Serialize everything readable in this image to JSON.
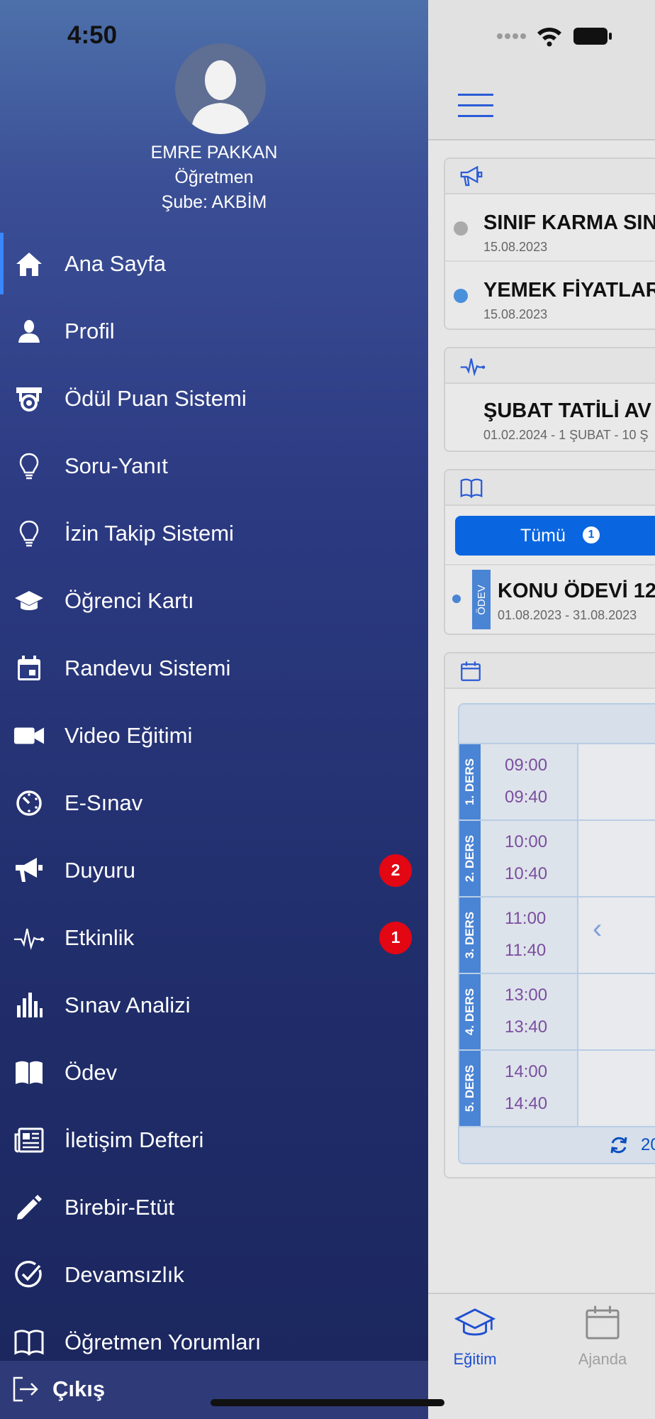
{
  "status": {
    "time": "4:50"
  },
  "profile": {
    "name": "EMRE PAKKAN",
    "role": "Öğretmen",
    "branch": "Şube: AKBİM"
  },
  "menu": [
    {
      "label": "Ana Sayfa",
      "icon": "home-icon",
      "active": true
    },
    {
      "label": "Profil",
      "icon": "person-icon"
    },
    {
      "label": "Ödül Puan Sistemi",
      "icon": "award-icon"
    },
    {
      "label": "Soru-Yanıt",
      "icon": "lightbulb-icon"
    },
    {
      "label": "İzin Takip Sistemi",
      "icon": "lightbulb-icon"
    },
    {
      "label": "Öğrenci Kartı",
      "icon": "graduation-cap-icon"
    },
    {
      "label": "Randevu Sistemi",
      "icon": "calendar-icon"
    },
    {
      "label": "Video Eğitimi",
      "icon": "video-camera-icon"
    },
    {
      "label": "E-Sınav",
      "icon": "timer-icon"
    },
    {
      "label": "Duyuru",
      "icon": "megaphone-icon",
      "badge": "2"
    },
    {
      "label": "Etkinlik",
      "icon": "activity-icon",
      "badge": "1"
    },
    {
      "label": "Sınav Analizi",
      "icon": "bar-chart-icon"
    },
    {
      "label": "Ödev",
      "icon": "book-icon"
    },
    {
      "label": "İletişim Defteri",
      "icon": "newspaper-icon"
    },
    {
      "label": "Birebir-Etüt",
      "icon": "pencil-icon"
    },
    {
      "label": "Devamsızlık",
      "icon": "check-circle-icon"
    },
    {
      "label": "Öğretmen Yorumları",
      "icon": "open-book-icon"
    }
  ],
  "logout": {
    "label": "Çıkış",
    "icon": "logout-icon"
  },
  "announcements": {
    "icon": "megaphone-icon",
    "items": [
      {
        "title": "SINIF KARMA SIN",
        "date": "15.08.2023",
        "dot_color": "#aaaaaa"
      },
      {
        "title": "YEMEK FİYATLAR",
        "date": "15.08.2023",
        "dot_color": "#4a8fdc"
      }
    ]
  },
  "events": {
    "icon": "activity-icon",
    "items": [
      {
        "title": "ŞUBAT TATİLİ AV",
        "date": "01.02.2024 - 1 ŞUBAT - 10 Ş"
      }
    ]
  },
  "homework": {
    "icon": "book-icon",
    "filter_label": "Tümü",
    "filter_count": "1",
    "items": [
      {
        "tag": "ÖDEV",
        "title": "KONU ÖDEVİ 12.",
        "date": "01.08.2023 -  31.08.2023"
      }
    ]
  },
  "schedule": {
    "icon": "calendar-icon",
    "lessons": [
      {
        "label": "1. DERS",
        "start": "09:00",
        "end": "09:40"
      },
      {
        "label": "2. DERS",
        "start": "10:00",
        "end": "10:40"
      },
      {
        "label": "3. DERS",
        "start": "11:00",
        "end": "11:40"
      },
      {
        "label": "4. DERS",
        "start": "13:00",
        "end": "13:40"
      },
      {
        "label": "5. DERS",
        "start": "14:00",
        "end": "14:40"
      }
    ],
    "prev_symbol": "‹",
    "footer_year": "20"
  },
  "tabs": [
    {
      "label": "Eğitim",
      "icon": "graduation-cap-icon",
      "active": true,
      "color": "#1f4fd0"
    },
    {
      "label": "Ajanda",
      "icon": "calendar-icon",
      "active": false,
      "color": "#a0a0a0"
    }
  ]
}
